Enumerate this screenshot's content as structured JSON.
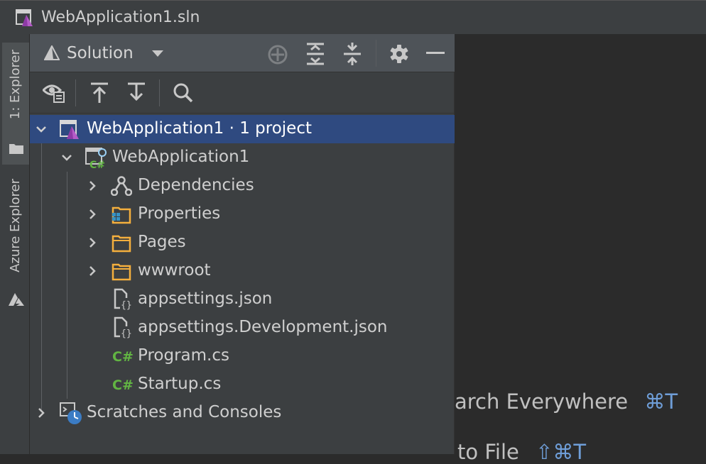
{
  "window": {
    "title": "WebApplication1.sln"
  },
  "tool_stripe": {
    "tabs": [
      {
        "label": "1: Explorer",
        "icon": "folder-icon",
        "active": true
      },
      {
        "label": "Azure Explorer",
        "icon": "azure-icon",
        "active": false
      }
    ]
  },
  "explorer": {
    "view_selector": {
      "label": "Solution",
      "icon": "solution-icon"
    },
    "header_actions": [
      "locate-icon",
      "expand-all-icon",
      "collapse-all-icon",
      "gear-icon",
      "minimize-icon"
    ],
    "toolbar_actions": [
      "show-options-icon",
      "collapse-up-icon",
      "expand-down-icon",
      "search-icon"
    ],
    "tree": [
      {
        "label": "WebApplication1",
        "suffix": " · 1 project",
        "icon": "solution-file-icon",
        "level": 0,
        "expanded": true,
        "selected": true
      },
      {
        "label": "WebApplication1",
        "icon": "csharp-project-icon",
        "level": 1,
        "expanded": true
      },
      {
        "label": "Dependencies",
        "icon": "dependencies-icon",
        "level": 2,
        "expanded": false
      },
      {
        "label": "Properties",
        "icon": "properties-folder-icon",
        "level": 2,
        "expanded": false
      },
      {
        "label": "Pages",
        "icon": "folder-icon",
        "level": 2,
        "expanded": false
      },
      {
        "label": "wwwroot",
        "icon": "folder-icon",
        "level": 2,
        "expanded": false
      },
      {
        "label": "appsettings.json",
        "icon": "json-file-icon",
        "level": 2
      },
      {
        "label": "appsettings.Development.json",
        "icon": "json-file-icon",
        "level": 2
      },
      {
        "label": "Program.cs",
        "icon": "csharp-file-icon",
        "level": 2
      },
      {
        "label": "Startup.cs",
        "icon": "csharp-file-icon",
        "level": 2
      },
      {
        "label": "Scratches and Consoles",
        "icon": "scratches-icon",
        "level": 0,
        "expanded": false
      }
    ]
  },
  "editor_hints": [
    {
      "text": "arch Everywhere",
      "shortcut": "⌘T"
    },
    {
      "text": "to File",
      "shortcut": "⇧⌘T"
    }
  ],
  "colors": {
    "selection": "#2f4a80",
    "csharp_green": "#62b543",
    "folder_orange": "#f4af3d",
    "shortcut_blue": "#6f9ed8"
  }
}
